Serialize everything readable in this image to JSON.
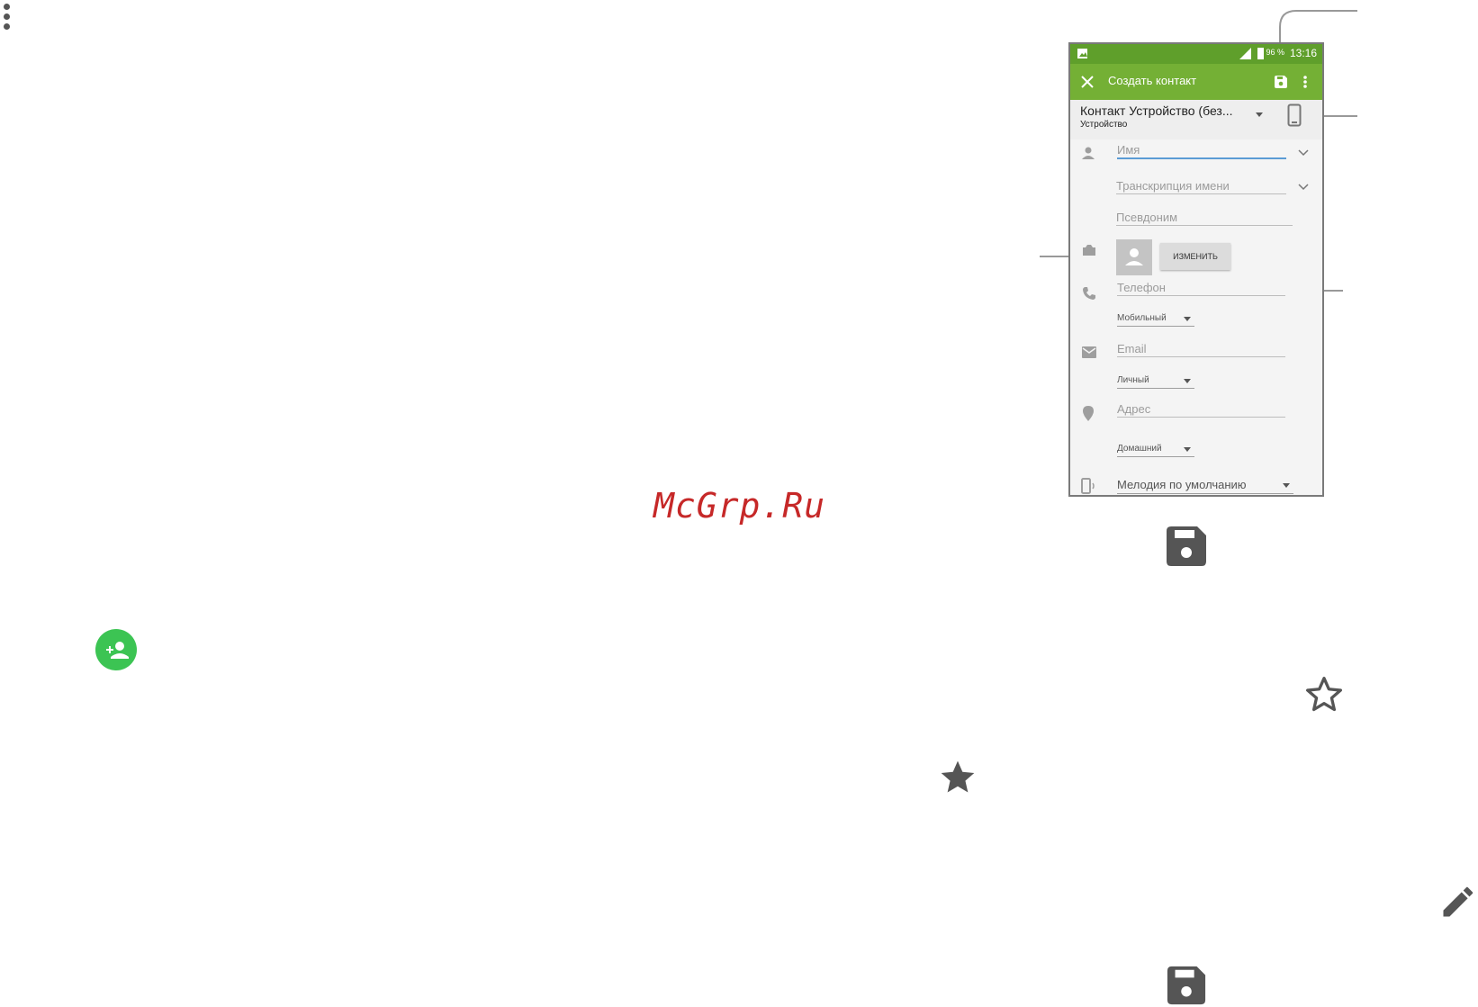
{
  "watermark": "McGrp.Ru",
  "phone": {
    "status": {
      "battery": "96 %",
      "time": "13:16"
    },
    "app_bar": {
      "title": "Создать контакт"
    },
    "account": {
      "name": "Контакт Устройство (без...",
      "type": "Устройство"
    },
    "fields": {
      "name_placeholder": "Имя",
      "phonetic_placeholder": "Транскрипция имени",
      "nickname_placeholder": "Псевдоним",
      "change_button": "ИЗМЕНИТЬ",
      "phone_placeholder": "Телефон",
      "phone_type": "Мобильный",
      "email_placeholder": "Email",
      "email_type": "Личный",
      "address_placeholder": "Адрес",
      "address_type": "Домашний",
      "ringtone": "Мелодия по умолчанию"
    }
  },
  "colors": {
    "status_bar": "#5f9f2b",
    "app_bar": "#74b035",
    "fab": "#3cc453",
    "icon_dark": "#555555",
    "watermark": "#c62828"
  }
}
